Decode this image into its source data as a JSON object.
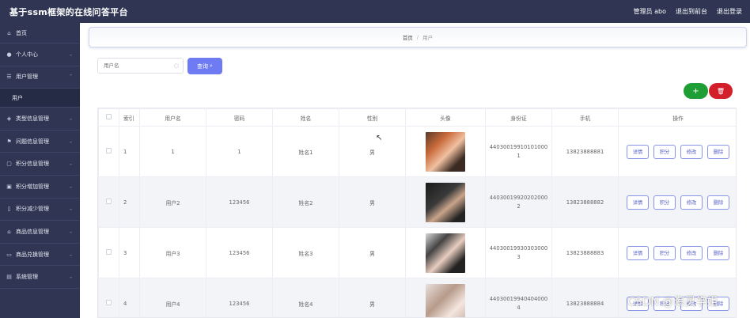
{
  "header": {
    "title": "基于ssm框架的在线问答平台",
    "admin_label": "管理员 abo",
    "exit_front": "退出到前台",
    "logout": "退出登录"
  },
  "sidebar": {
    "items": [
      {
        "label": "首页",
        "icon": "home-icon",
        "expanded": false
      },
      {
        "label": "个人中心",
        "icon": "user-icon",
        "expanded": false
      },
      {
        "label": "用户管理",
        "icon": "list-icon",
        "expanded": true
      },
      {
        "label": "用户",
        "icon": "",
        "sub": true
      },
      {
        "label": "类型信息管理",
        "icon": "tags-icon",
        "expanded": false
      },
      {
        "label": "问题信息管理",
        "icon": "flag-icon",
        "expanded": false
      },
      {
        "label": "积分信息管理",
        "icon": "box-icon",
        "expanded": false
      },
      {
        "label": "积分增加管理",
        "icon": "wallet-icon",
        "expanded": false
      },
      {
        "label": "积分减少管理",
        "icon": "phone-icon",
        "expanded": false
      },
      {
        "label": "商品信息管理",
        "icon": "shop-icon",
        "expanded": false
      },
      {
        "label": "商品兑换管理",
        "icon": "exchange-icon",
        "expanded": false
      },
      {
        "label": "系统管理",
        "icon": "system-icon",
        "expanded": false
      }
    ]
  },
  "breadcrumb": {
    "home": "首页",
    "separator": "/",
    "current": "用户"
  },
  "search": {
    "placeholder": "用户名",
    "value": "",
    "button_label": "查询"
  },
  "actions": {
    "add_label": "+",
    "delete_label": "🗑"
  },
  "table": {
    "headers": [
      "",
      "索引",
      "用户名",
      "密码",
      "姓名",
      "性别",
      "头像",
      "身份证",
      "手机",
      "操作"
    ],
    "rows": [
      {
        "index": "1",
        "username": "1",
        "password": "1",
        "name": "姓名1",
        "gender": "男",
        "id_line1": "44030019910101000",
        "id_line2": "1",
        "phone": "13823888881"
      },
      {
        "index": "2",
        "username": "用户2",
        "password": "123456",
        "name": "姓名2",
        "gender": "男",
        "id_line1": "44030019920202000",
        "id_line2": "2",
        "phone": "13823888882"
      },
      {
        "index": "3",
        "username": "用户3",
        "password": "123456",
        "name": "姓名3",
        "gender": "男",
        "id_line1": "44030019930303000",
        "id_line2": "3",
        "phone": "13823888883"
      },
      {
        "index": "4",
        "username": "用户4",
        "password": "123456",
        "name": "姓名4",
        "gender": "男",
        "id_line1": "44030019940404000",
        "id_line2": "4",
        "phone": "13823888884"
      }
    ],
    "ops": [
      "详情",
      "积分",
      "修改",
      "删除"
    ]
  },
  "watermark": "CSDN @海灵学姐",
  "colors": {
    "nav_bg": "#2f3553",
    "primary": "#6e7bf2",
    "add": "#1e9e35",
    "delete": "#d21f2a"
  }
}
